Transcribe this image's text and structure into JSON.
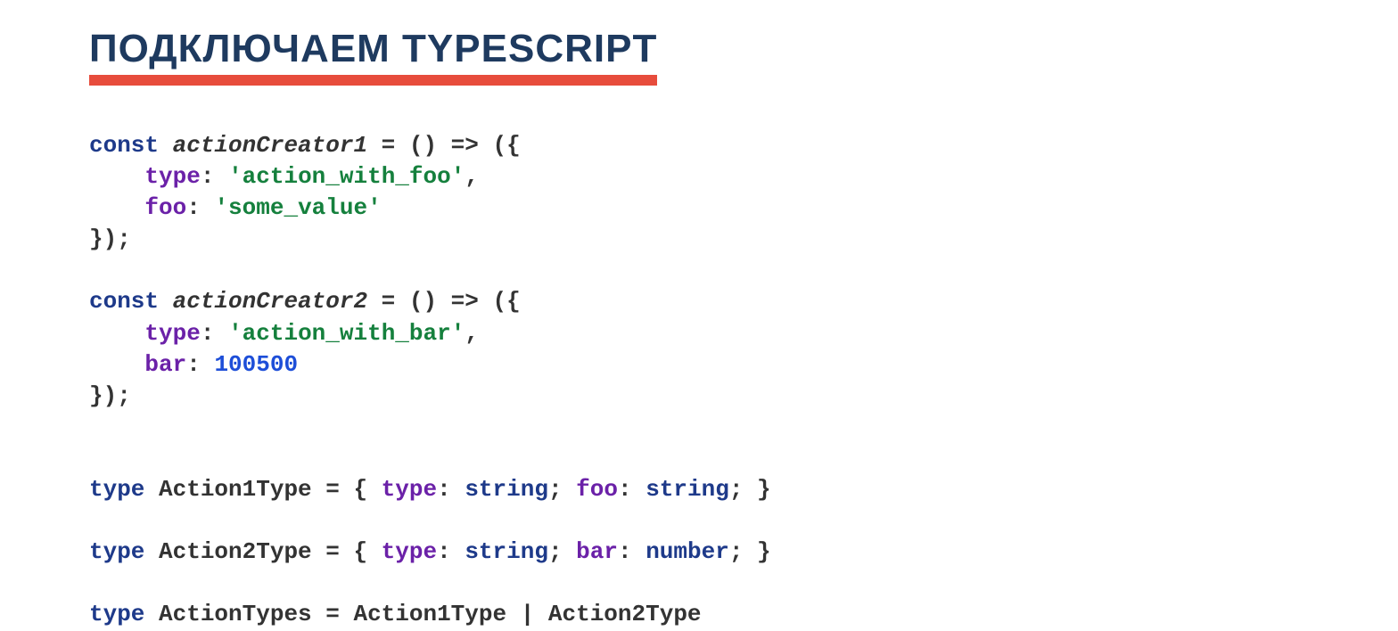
{
  "heading": "ПОДКЛЮЧАЕМ TYPESCRIPT",
  "code": {
    "l1": {
      "const": "const",
      "name": "actionCreator1",
      "rest": " = () => ({"
    },
    "l2": {
      "prop": "type",
      "colon": ": ",
      "val": "'action_with_foo'",
      "comma": ","
    },
    "l3": {
      "prop": "foo",
      "colon": ": ",
      "val": "'some_value'"
    },
    "l4": "});",
    "l5": {
      "const": "const",
      "name": "actionCreator2",
      "rest": " = () => ({"
    },
    "l6": {
      "prop": "type",
      "colon": ": ",
      "val": "'action_with_bar'",
      "comma": ","
    },
    "l7": {
      "prop": "bar",
      "colon": ": ",
      "val": "100500"
    },
    "l8": "});",
    "l9": {
      "kw": "type",
      "name": " Action1Type = { ",
      "p1": "type",
      "c1": ": ",
      "t1": "string",
      "s1": "; ",
      "p2": "foo",
      "c2": ": ",
      "t2": "string",
      "s2": "; }"
    },
    "l10": {
      "kw": "type",
      "name": " Action2Type = { ",
      "p1": "type",
      "c1": ": ",
      "t1": "string",
      "s1": "; ",
      "p2": "bar",
      "c2": ": ",
      "t2": "number",
      "s2": "; }"
    },
    "l11": {
      "kw": "type",
      "rest": " ActionTypes = Action1Type | Action2Type"
    }
  }
}
